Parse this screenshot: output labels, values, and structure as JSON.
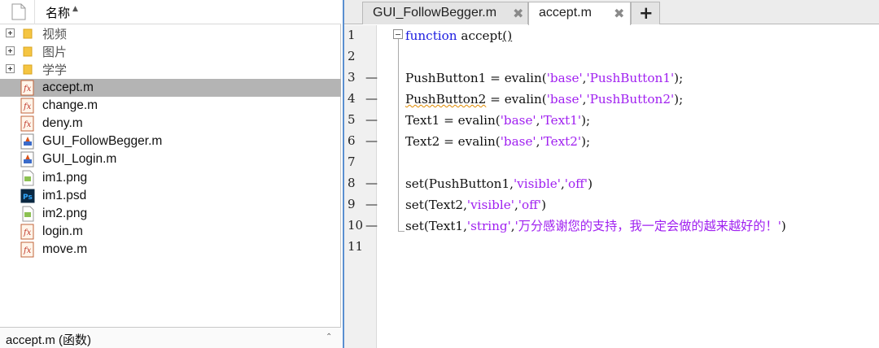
{
  "browser": {
    "header_label": "名称",
    "folders": [
      {
        "label": "视频"
      },
      {
        "label": "图片"
      },
      {
        "label": "学学"
      }
    ],
    "files": [
      {
        "name": "accept.m",
        "icon": "matlab-function-icon",
        "selected": true
      },
      {
        "name": "change.m",
        "icon": "matlab-function-icon"
      },
      {
        "name": "deny.m",
        "icon": "matlab-function-icon"
      },
      {
        "name": "GUI_FollowBegger.m",
        "icon": "matlab-gui-icon"
      },
      {
        "name": "GUI_Login.m",
        "icon": "matlab-gui-icon"
      },
      {
        "name": "im1.png",
        "icon": "image-file-icon"
      },
      {
        "name": "im1.psd",
        "icon": "photoshop-file-icon"
      },
      {
        "name": "im2.png",
        "icon": "image-file-icon"
      },
      {
        "name": "login.m",
        "icon": "matlab-function-icon"
      },
      {
        "name": "move.m",
        "icon": "matlab-function-icon"
      }
    ],
    "status": "accept.m  (函数)"
  },
  "editor": {
    "tabs": [
      {
        "label": "GUI_FollowBegger.m",
        "active": false
      },
      {
        "label": "accept.m",
        "active": true
      }
    ],
    "add_tab": "+",
    "close_glyph": "✖",
    "line_numbers": [
      "1",
      "2",
      "3",
      "4",
      "5",
      "6",
      "7",
      "8",
      "9",
      "10",
      "11"
    ],
    "breakpoint_lines": [
      3,
      4,
      5,
      6,
      8,
      9,
      10
    ],
    "code": {
      "l1_kw": "function",
      "l1_name": " accept",
      "l1_parens": "()",
      "l3": [
        "PushButton1 = evalin(",
        "'base'",
        ",",
        "'PushButton1'",
        ");"
      ],
      "l4": [
        "PushButton2",
        " = evalin(",
        "'base'",
        ",",
        "'PushButton2'",
        ");"
      ],
      "l5": [
        "Text1 = evalin(",
        "'base'",
        ",",
        "'Text1'",
        ");"
      ],
      "l6": [
        "Text2 = evalin(",
        "'base'",
        ",",
        "'Text2'",
        ");"
      ],
      "l8": [
        "set(PushButton1,",
        "'visible'",
        ",",
        "'off'",
        ")"
      ],
      "l9": [
        "set(Text2,",
        "'visible'",
        ",",
        "'off'",
        ")"
      ],
      "l10": [
        "set(Text1,",
        "'string'",
        ",",
        "'万分感谢您的支持，我一定会做的越来越好的！'",
        ")"
      ]
    },
    "colors": {
      "keyword": "#1a1ae0",
      "string": "#a020f0",
      "accent": "#5a8fd0"
    }
  }
}
